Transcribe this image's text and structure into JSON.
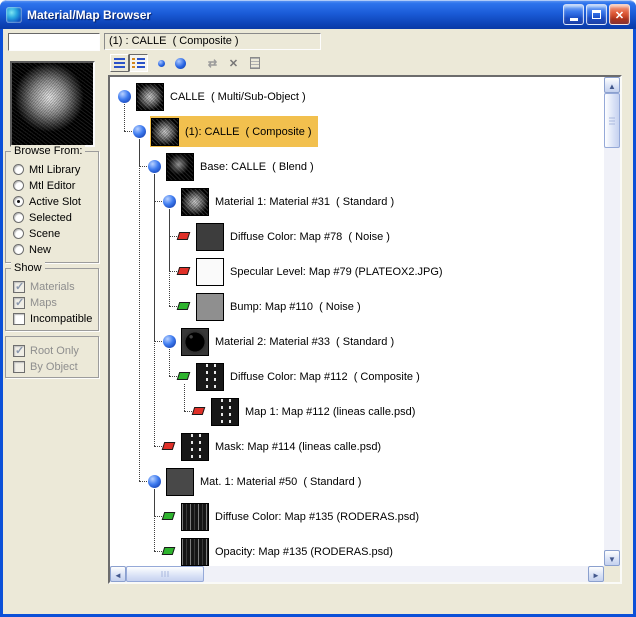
{
  "window": {
    "title": "Material/Map Browser",
    "app_icon": "3ds-max-logo",
    "controls": [
      {
        "name": "minimize-button"
      },
      {
        "name": "maximize-button"
      },
      {
        "name": "close-button"
      }
    ]
  },
  "colors": {
    "face": "#ece9d8",
    "frame_blue": "#0b50d8",
    "selection_yellow": "#f2c04e",
    "map_enabled_green": "#2eb42e",
    "map_disabled_red": "#e03028",
    "material_blue": "#2e6ce8"
  },
  "header": {
    "name_value": "",
    "path_label": "(1) : CALLE  ( Composite )"
  },
  "toolbar": {
    "buttons": [
      {
        "name": "view-list-button",
        "icon": "list-icon",
        "state": "raised"
      },
      {
        "name": "view-list-plus-icons-button",
        "icon": "list-plus-icons-icon",
        "state": "pressed"
      },
      {
        "name": "view-small-icons-button",
        "icon": "small-sphere-icon",
        "state": "flat"
      },
      {
        "name": "view-large-icons-button",
        "icon": "large-sphere-icon",
        "state": "flat"
      },
      {
        "name": "update-scene-materials-button",
        "icon": "update-materials-icon",
        "state": "disabled"
      },
      {
        "name": "delete-from-library-button",
        "icon": "delete-x-icon",
        "state": "disabled"
      },
      {
        "name": "clear-library-button",
        "icon": "clear-library-icon",
        "state": "disabled"
      }
    ]
  },
  "left_panel": {
    "preview": "material-preview-sphere",
    "browse_from": {
      "label": "Browse From:",
      "options": [
        {
          "label": "Mtl Library",
          "selected": false
        },
        {
          "label": "Mtl Editor",
          "selected": false
        },
        {
          "label": "Active Slot",
          "selected": true
        },
        {
          "label": "Selected",
          "selected": false
        },
        {
          "label": "Scene",
          "selected": false
        },
        {
          "label": "New",
          "selected": false
        }
      ]
    },
    "show": {
      "label": "Show",
      "options": [
        {
          "label": "Materials",
          "checked": true,
          "disabled": true
        },
        {
          "label": "Maps",
          "checked": true,
          "disabled": true
        },
        {
          "label": "Incompatible",
          "checked": false,
          "disabled": false
        }
      ]
    },
    "file_group": {
      "options": [
        {
          "label": "Root Only",
          "checked": true,
          "disabled": true
        },
        {
          "label": "By Object",
          "checked": false,
          "disabled": true
        }
      ]
    }
  },
  "tree": {
    "items": [
      {
        "label": "CALLE  ( Multi/Sub-Object )",
        "indent": 0,
        "marker": "material",
        "thumb": "sphere-noise",
        "selected": false
      },
      {
        "label": "(1): CALLE  ( Composite )",
        "indent": 1,
        "marker": "material",
        "thumb": "sphere-noise",
        "selected": true
      },
      {
        "label": "Base: CALLE  ( Blend )",
        "indent": 2,
        "marker": "material",
        "thumb": "sphere-dark",
        "selected": false
      },
      {
        "label": "Material 1: Material #31  ( Standard )",
        "indent": 3,
        "marker": "material",
        "thumb": "sphere-noise",
        "selected": false
      },
      {
        "label": "Diffuse Color: Map #78  ( Noise )",
        "indent": 4,
        "marker": "map-hidden",
        "thumb": "solid-dark",
        "selected": false
      },
      {
        "label": "Specular Level: Map #79 (PLATEOX2.JPG)",
        "indent": 4,
        "marker": "map-hidden",
        "thumb": "solid-white",
        "selected": false
      },
      {
        "label": "Bump: Map #110  ( Noise )",
        "indent": 4,
        "marker": "map-shown",
        "thumb": "solid-gray",
        "selected": false
      },
      {
        "label": "Material 2: Material #33  ( Standard )",
        "indent": 3,
        "marker": "material",
        "thumb": "sphere-black",
        "selected": false
      },
      {
        "label": "Diffuse Color: Map #112  ( Composite )",
        "indent": 4,
        "marker": "map-shown",
        "thumb": "stripes",
        "selected": false
      },
      {
        "label": "Map 1: Map #112 (lineas calle.psd)",
        "indent": 5,
        "marker": "map-hidden",
        "thumb": "stripes",
        "selected": false
      },
      {
        "label": "Mask: Map #114 (lineas calle.psd)",
        "indent": 3,
        "marker": "map-hidden",
        "thumb": "stripes",
        "selected": false
      },
      {
        "label": "Mat. 1: Material #50  ( Standard )",
        "indent": 2,
        "marker": "material",
        "thumb": "solid-dark2",
        "selected": false
      },
      {
        "label": "Diffuse Color: Map #135 (RODERAS.psd)",
        "indent": 3,
        "marker": "map-shown",
        "thumb": "roderas",
        "selected": false
      },
      {
        "label": "Opacity: Map #135 (RODERAS.psd)",
        "indent": 3,
        "marker": "map-shown",
        "thumb": "roderas",
        "selected": false
      }
    ]
  }
}
